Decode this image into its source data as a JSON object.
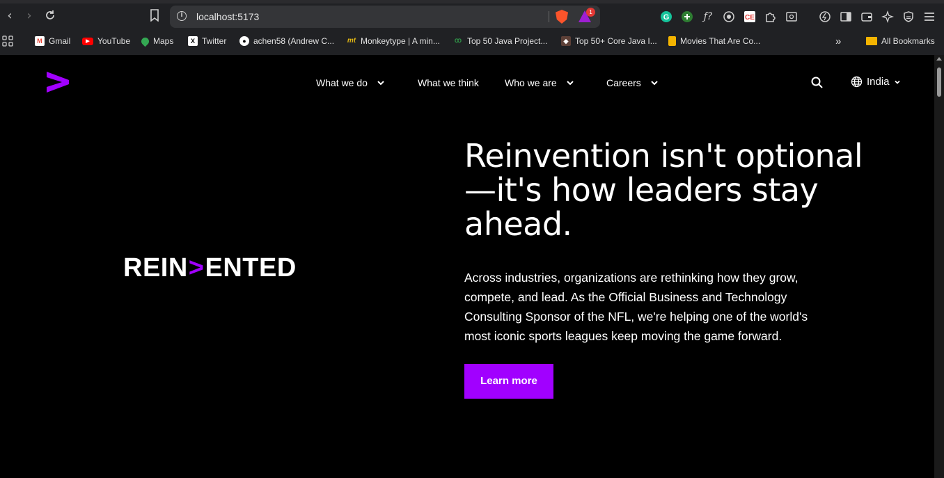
{
  "browser": {
    "url": "localhost:5173",
    "rewards_badge": "1",
    "bookmarks": [
      {
        "label": "Gmail",
        "icon": "gmail-icon"
      },
      {
        "label": "YouTube",
        "icon": "youtube-icon"
      },
      {
        "label": "Maps",
        "icon": "maps-icon"
      },
      {
        "label": "Twitter",
        "icon": "x-icon"
      },
      {
        "label": "achen58 (Andrew C...",
        "icon": "github-icon"
      },
      {
        "label": "Monkeytype | A min...",
        "icon": "monkeytype-icon"
      },
      {
        "label": "Top 50 Java Project...",
        "icon": "gfg-icon"
      },
      {
        "label": "Top 50+ Core Java I...",
        "icon": "cube-icon"
      },
      {
        "label": "Movies That Are Co...",
        "icon": "bookmark-icon"
      }
    ],
    "overflow_label": "»",
    "all_bookmarks_label": "All Bookmarks"
  },
  "site": {
    "brand_color": "#a100ff",
    "nav": [
      {
        "label": "What we do",
        "has_dropdown": true
      },
      {
        "label": "What we think",
        "has_dropdown": false
      },
      {
        "label": "Who we are",
        "has_dropdown": true
      },
      {
        "label": "Careers",
        "has_dropdown": true
      }
    ],
    "language": "India"
  },
  "hero": {
    "brand_word_left": "REIN",
    "brand_word_mark": ">",
    "brand_word_right": "ENTED",
    "headline_l1": "Reinvention isn't optional",
    "headline_l2": "—it's how leaders stay",
    "headline_l3": "ahead.",
    "body": "Across industries, organizations are rethinking how they grow, compete, and lead. As the Official Business and Technology Consulting Sponsor of the NFL, we're helping one of the world's most iconic sports leagues keep moving the game forward.",
    "cta_label": "Learn more"
  }
}
